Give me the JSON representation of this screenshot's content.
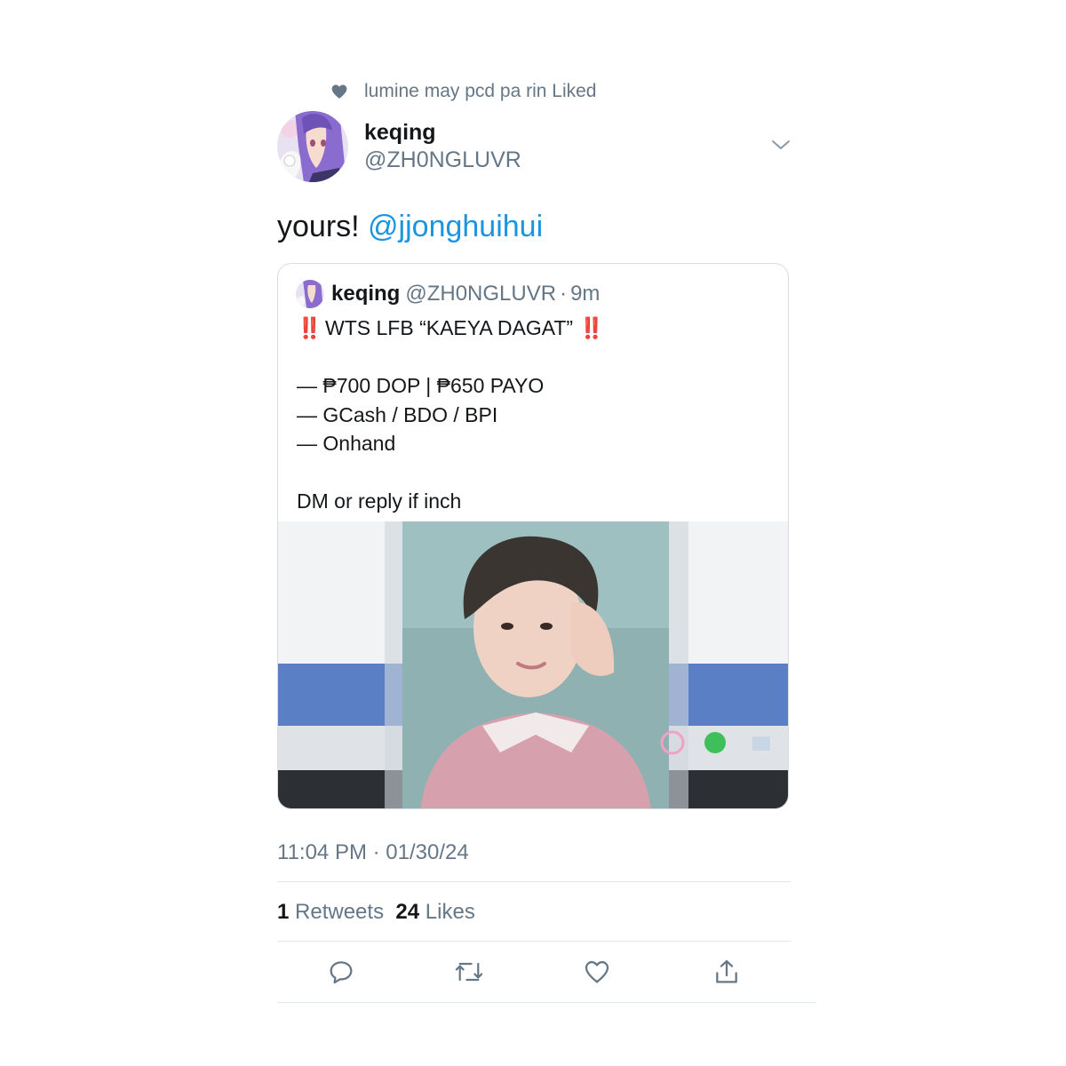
{
  "social_context": {
    "text": "lumine may pcd pa rin Liked"
  },
  "tweet": {
    "author_name": "keqing",
    "author_handle": "@ZH0NGLUVR",
    "text_prefix": "yours! ",
    "mention": "@jjonghuihui",
    "timestamp": "11:04 PM · 01/30/24"
  },
  "quote": {
    "author_name": "keqing",
    "author_handle": "@ZH0NGLUVR",
    "separator": "·",
    "time": "9m",
    "bang_left": "‼️",
    "title": " WTS LFB “KAEYA DAGAT” ",
    "bang_right": "‼️",
    "lines": [
      "— ₱700 DOP | ₱650 PAYO",
      "— GCash / BDO / BPI",
      "— Onhand"
    ],
    "footer": "DM or reply if inch"
  },
  "stats": {
    "retweets_count": "1",
    "retweets_label": " Retweets",
    "likes_count": "24",
    "likes_label": " Likes"
  },
  "icons": {
    "heart": "heart-icon",
    "caret": "chevron-down-icon",
    "reply": "reply-icon",
    "retweet": "retweet-icon",
    "like": "like-icon",
    "share": "share-icon"
  },
  "colors": {
    "mention": "#1b95e0",
    "muted": "#657786",
    "text": "#14171a",
    "bang": "#d9262b"
  }
}
